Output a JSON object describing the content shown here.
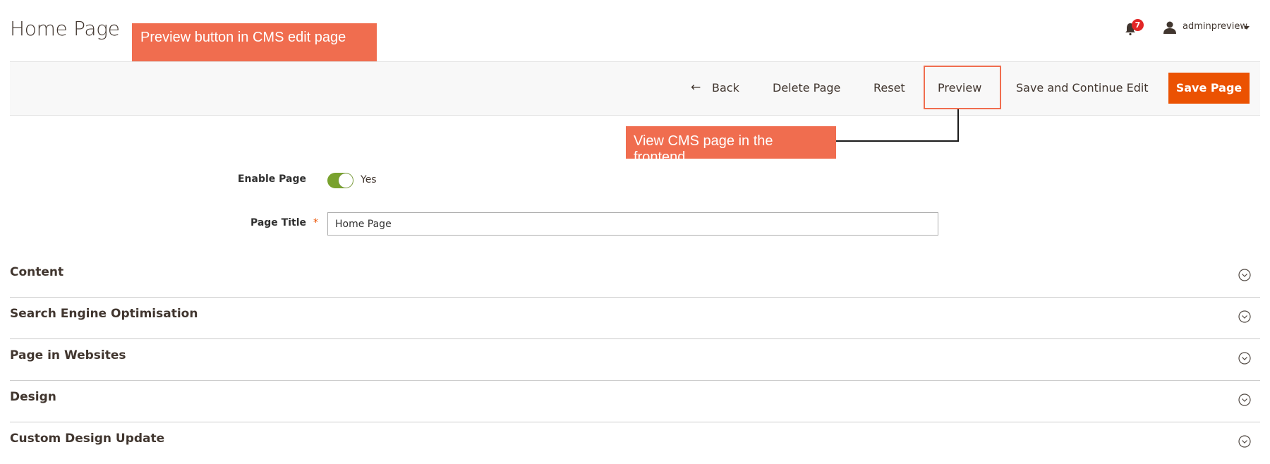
{
  "header": {
    "page_title": "Home Page",
    "notifications_count": "7",
    "user_name": "adminpreview"
  },
  "annotations": {
    "top_callout": "Preview button in CMS edit page",
    "preview_callout": "View CMS page in the frontend",
    "accent_color": "#f06d4f"
  },
  "toolbar": {
    "back_label": "Back",
    "delete_label": "Delete Page",
    "reset_label": "Reset",
    "preview_label": "Preview",
    "save_continue_label": "Save and Continue Edit",
    "save_label": "Save Page",
    "save_color": "#eb5202"
  },
  "form": {
    "enable_label": "Enable Page",
    "enable_value": "Yes",
    "enable_on": true,
    "title_label": "Page Title",
    "title_required": "*",
    "title_value": "Home Page"
  },
  "sections": [
    {
      "title": "Content"
    },
    {
      "title": "Search Engine Optimisation"
    },
    {
      "title": "Page in Websites"
    },
    {
      "title": "Design"
    },
    {
      "title": "Custom Design Update"
    }
  ]
}
